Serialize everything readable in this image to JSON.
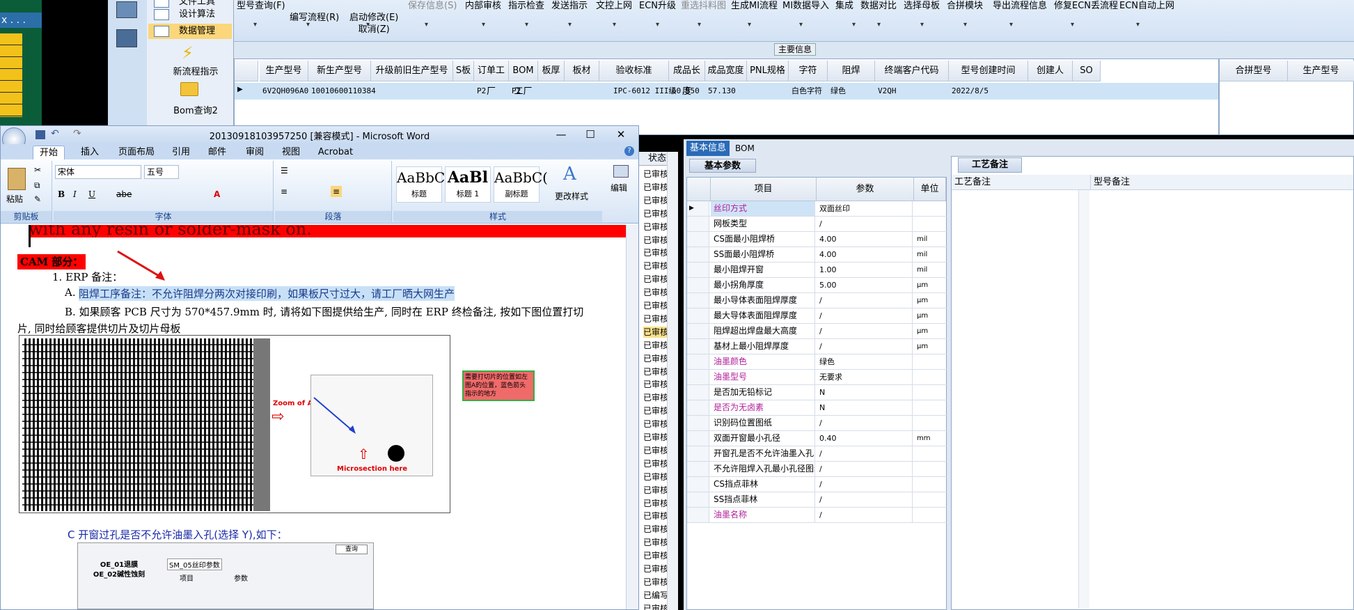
{
  "erp": {
    "left_header": "x . . .",
    "nav": {
      "items": [
        "设计算法",
        "数据管理",
        "新流程指示",
        "Bom查询2"
      ],
      "top_partial": "文件工具",
      "selected": "数据管理"
    },
    "toolbar": [
      {
        "l1": "型号查询(F)",
        "l2": ""
      },
      {
        "l1": "",
        "l2": "编写流程(R)"
      },
      {
        "l1": "",
        "l2": "启动修改(E)",
        "l3": "取消(Z)"
      },
      {
        "l1": "保存信息(S)",
        "l2": "",
        "disabled": true
      },
      {
        "l1": "内部审核",
        "l2": ""
      },
      {
        "l1": "指示检查",
        "l2": ""
      },
      {
        "l1": "发送指示",
        "l2": ""
      },
      {
        "l1": "文控上网",
        "l2": ""
      },
      {
        "l1": "ECN升级",
        "l2": ""
      },
      {
        "l1": "重选抖料图",
        "l2": "",
        "disabled": true
      },
      {
        "l1": "生成MI流程",
        "l2": ""
      },
      {
        "l1": "MI数据导入",
        "l2": ""
      },
      {
        "l1": "集成",
        "l2": ""
      },
      {
        "l1": "数据对比",
        "l2": ""
      },
      {
        "l1": "选择母板",
        "l2": ""
      },
      {
        "l1": "合拼模块",
        "l2": ""
      },
      {
        "l1": "导出流程信息",
        "l2": ""
      },
      {
        "l1": "修复ECN丢流程",
        "l2": ""
      },
      {
        "l1": "ECN自动上网",
        "l2": ""
      }
    ],
    "main_info_label": "主要信息",
    "grid": {
      "headers": [
        "生产型号",
        "新生产型号",
        "升级前旧生产型号",
        "S板",
        "订单工厂",
        "BOM工厂",
        "板厚",
        "板材",
        "验收标准",
        "成品长度",
        "成品宽度",
        "PNL规格",
        "字符",
        "阻焊",
        "终端客户代码",
        "型号创建时间",
        "创建人",
        "SO"
      ],
      "row": [
        "6V2QH096A0",
        "10010600110384",
        "",
        "",
        "P2",
        "P2",
        "",
        "",
        "IPC-6012 III级",
        "60.550",
        "57.130",
        "",
        "白色字符",
        "绿色",
        "V2QH",
        "2022/8/5",
        "",
        ""
      ]
    },
    "side_grid_headers": [
      "合拼型号",
      "生产型号"
    ],
    "status": {
      "header": "状态",
      "items": [
        "已审核",
        "已审核",
        "已审核",
        "已审核",
        "已审核",
        "已审核",
        "已审核",
        "已审核",
        "已审核",
        "已审核",
        "已审核",
        "已审核",
        "已审核",
        "已审核",
        "已审核",
        "已审核",
        "已审核",
        "已审核",
        "已审核",
        "已审核",
        "已审核",
        "已审核",
        "已审核",
        "已审核",
        "已审核",
        "已审核",
        "已审核",
        "已审核",
        "已审核",
        "已审核",
        "已审核",
        "已审核",
        "已编写",
        "已审核"
      ],
      "highlight_index": 12
    },
    "right_panel": {
      "tab_active": "基本信息",
      "tab_other": "BOM",
      "subtab": "基本参数",
      "headers": [
        "项目",
        "参数",
        "单位"
      ],
      "rows": [
        {
          "name": "丝印方式",
          "value": "双面丝印",
          "unit": "",
          "mag": true,
          "sel": true
        },
        {
          "name": "网板类型",
          "value": "/",
          "unit": ""
        },
        {
          "name": "CS面最小阻焊桥",
          "value": "4.00",
          "unit": "mil"
        },
        {
          "name": "SS面最小阻焊桥",
          "value": "4.00",
          "unit": "mil"
        },
        {
          "name": "最小阻焊开窗",
          "value": "1.00",
          "unit": "mil"
        },
        {
          "name": "最小拐角厚度",
          "value": "5.00",
          "unit": "μm"
        },
        {
          "name": "最小导体表面阻焊厚度",
          "value": "/",
          "unit": "μm"
        },
        {
          "name": "最大导体表面阻焊厚度",
          "value": "/",
          "unit": "μm"
        },
        {
          "name": "阻焊超出焊盘最大高度",
          "value": "/",
          "unit": "μm"
        },
        {
          "name": "基材上最小阻焊厚度",
          "value": "/",
          "unit": "μm"
        },
        {
          "name": "油墨颜色",
          "value": "绿色",
          "unit": "",
          "mag": true
        },
        {
          "name": "油墨型号",
          "value": "无要求",
          "unit": "",
          "mag": true
        },
        {
          "name": "是否加无铅标记",
          "value": "N",
          "unit": ""
        },
        {
          "name": "是否为无卤素",
          "value": "N",
          "unit": "",
          "mag": true
        },
        {
          "name": "识别码位置图纸",
          "value": "/",
          "unit": ""
        },
        {
          "name": "双面开窗最小孔径",
          "value": "0.40",
          "unit": "mm"
        },
        {
          "name": "开窗孔是否不允许油墨入孔",
          "value": "/",
          "unit": ""
        },
        {
          "name": "不允许阻焊入孔最小孔径图纸",
          "value": "/",
          "unit": ""
        },
        {
          "name": "CS挡点菲林",
          "value": "/",
          "unit": ""
        },
        {
          "name": "SS挡点菲林",
          "value": "/",
          "unit": ""
        },
        {
          "name": "油墨名称",
          "value": "/",
          "unit": "",
          "mag": true
        }
      ],
      "process_tab": "工艺备注",
      "process_headers": [
        "工艺备注",
        "型号备注"
      ]
    }
  },
  "word": {
    "title": "20130918103957250 [兼容模式] - Microsoft Word",
    "tabs": [
      "开始",
      "插入",
      "页面布局",
      "引用",
      "邮件",
      "审阅",
      "视图",
      "Acrobat"
    ],
    "ribbon": {
      "paste": "粘贴",
      "clipboard": "剪贴板",
      "font_name": "宋体",
      "font_size": "五号",
      "font": "字体",
      "paragraph": "段落",
      "styles": "样式",
      "style_items": [
        {
          "sample": "AaBbC(",
          "name": "标题"
        },
        {
          "sample": "AaBl",
          "name": "标题 1"
        },
        {
          "sample": "AaBbC(",
          "name": "副标题"
        }
      ],
      "change_styles": "更改样式",
      "edit": "编辑"
    },
    "doc": {
      "red_line": "with any resin or solder-mask on.",
      "cam": "CAM 部分：",
      "erp_note": "1. ERP 备注：",
      "a_prefix": "A.",
      "a_text": "阻焊工序备注：不允许阻焊分两次对接印刷，如果板尺寸过大，请工厂晒大网生产",
      "b_line1": "B. 如果顾客 PCB 尺寸为 570*457.9mm 时, 请将如下图提供给生产, 同时在 ERP 终检备注, 按如下图位置打切",
      "b_line2": "片, 同时给顾客提供切片及切片母板",
      "zoom_label": "Zoom of A",
      "micro_label": "Microsection here",
      "note_box": "需要打切片的位置如左图A的位置，蓝色箭头指示的地方",
      "c_line": "C 开窗过孔是否不允许油墨入孔(选择 Y),如下：",
      "sub_tabs": [
        "OE_01退膜",
        "OE_02碱性蚀刻"
      ],
      "sub_panel": "SM_05丝印参数",
      "sub_head": [
        "项目",
        "参数"
      ],
      "sub_btn": "查询"
    }
  },
  "colors": {
    "accent": "#2a6bb8",
    "selected_nav": "#fbd67a",
    "red_bar": "#ff0000",
    "highlight_text": "#c7e0f7",
    "magenta": "#b0209a"
  }
}
